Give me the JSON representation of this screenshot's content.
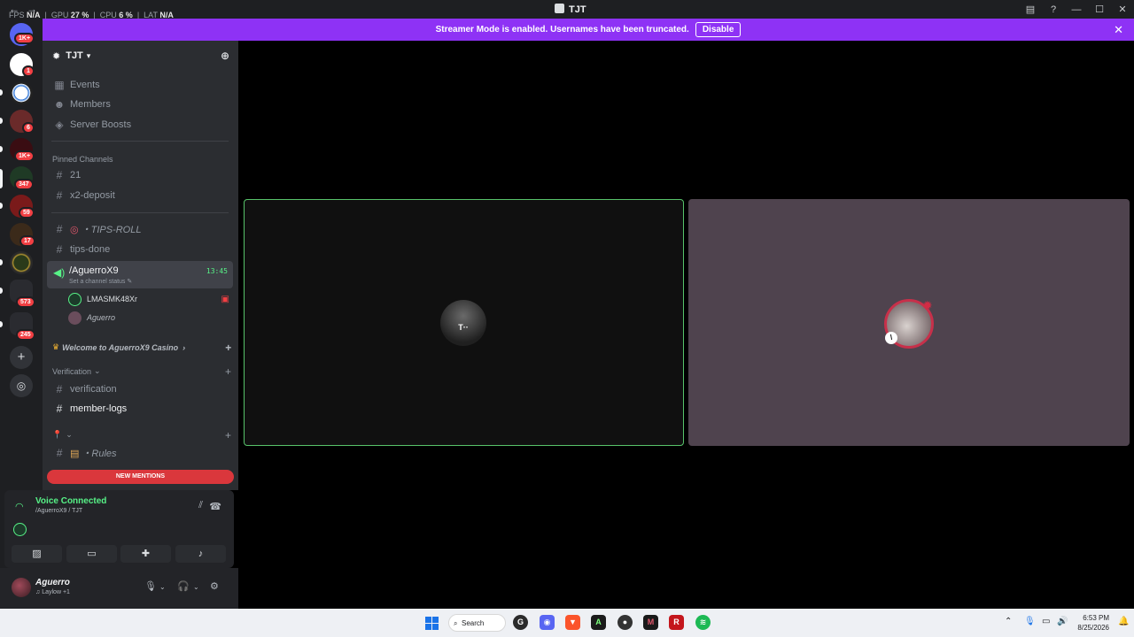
{
  "titlebar": {
    "title": "TJT",
    "stats": {
      "fps_label": "FPS",
      "fps": "N/A",
      "gpu_label": "GPU",
      "gpu": "27 %",
      "cpu_label": "CPU",
      "cpu": "6 %",
      "lat_label": "LAT",
      "lat": "N/A"
    }
  },
  "banner": {
    "text": "Streamer Mode is enabled. Usernames have been truncated.",
    "disable_label": "Disable"
  },
  "guilds": {
    "badges": [
      "1K+",
      "1",
      "6",
      "1K+",
      "347",
      "59",
      "17",
      "573",
      "245"
    ]
  },
  "server": {
    "name": "TJT"
  },
  "nav": {
    "events": "Events",
    "members": "Members",
    "boosts": "Server Boosts"
  },
  "pinned": {
    "label": "Pinned Channels",
    "items": [
      "21",
      "x2-deposit"
    ]
  },
  "channels": {
    "tips_roll": "・TIPS-ROLL",
    "tips_done": "tips-done",
    "voice": {
      "name": "/AguerroX9",
      "status": "Set a channel status",
      "time": "13:45"
    },
    "voice_users": [
      "LMASMK48Xr",
      "Aguerro"
    ],
    "welcome_cat": "Welcome to AguerroX9 Casino",
    "verification_cat": "Verification",
    "verification": "verification",
    "member_logs": "member-logs",
    "rules": "・Rules"
  },
  "new_mentions": "NEW MENTIONS",
  "panel": {
    "title": "Voice Connected",
    "subtitle": "/AguerroX9 / TJT"
  },
  "user": {
    "name": "Aguerro",
    "status": "Laylow +1"
  },
  "taskbar": {
    "search": "Search",
    "time": "6:53 PM",
    "date": "8/25/2026"
  },
  "colors": {
    "accent": "#8e32f5",
    "online": "#57f287",
    "danger": "#da373c",
    "tile_border": "#57c36a"
  }
}
